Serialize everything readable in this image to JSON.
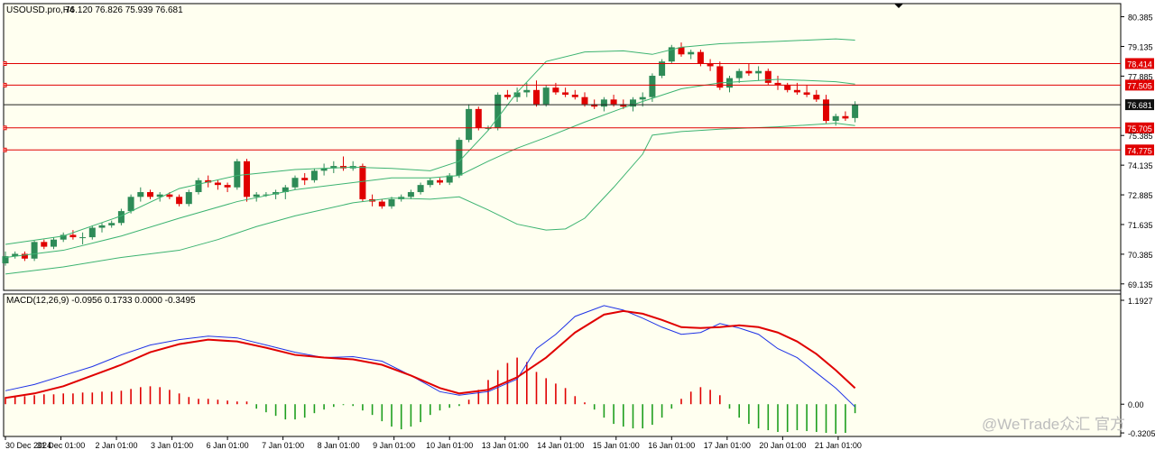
{
  "header": {
    "symbol": "USOUSD.pro,H4",
    "ohlc": "76.120 76.826 75.939 76.681"
  },
  "macd_header": "MACD(12,26,9) -0.0956 0.1733 0.0000 -0.3495",
  "watermark": "@WeTrade众汇 官方",
  "colors": {
    "background": "#fffff0",
    "bull_candle": "#2e8b57",
    "bear_candle": "#e00000",
    "bollinger": "#3cb371",
    "hline": "#e00000",
    "current_price_line": "#202020",
    "macd_line": "#1e32e6",
    "signal_line": "#e00000",
    "hist_pos": "#e00000",
    "hist_neg": "#1e9e1e"
  },
  "chart_data": [
    {
      "type": "candlestick",
      "title": "USOUSD.pro,H4",
      "ylim": [
        68.9,
        80.9
      ],
      "y_ticks": [
        "80.385",
        "79.135",
        "77.885",
        "75.385",
        "74.135",
        "72.885",
        "71.635",
        "70.385",
        "69.135"
      ],
      "horizontal_levels": [
        {
          "price": 78.414,
          "label": "78.414"
        },
        {
          "price": 77.505,
          "label": "77.505"
        },
        {
          "price": 75.705,
          "label": "75.705"
        },
        {
          "price": 74.775,
          "label": "74.775"
        }
      ],
      "current_price": {
        "price": 76.681,
        "label": "76.681"
      },
      "x_labels": [
        "30 Dec 2024",
        "31 Dec 01:00",
        "2 Jan 01:00",
        "3 Jan 01:00",
        "6 Jan 01:00",
        "7 Jan 01:00",
        "8 Jan 01:00",
        "9 Jan 01:00",
        "10 Jan 01:00",
        "13 Jan 01:00",
        "14 Jan 01:00",
        "15 Jan 01:00",
        "16 Jan 01:00",
        "17 Jan 01:00",
        "20 Jan 01:00",
        "21 Jan 01:00"
      ],
      "candles": [
        [
          70.0,
          70.5,
          69.9,
          70.3
        ],
        [
          70.3,
          70.5,
          70.2,
          70.4
        ],
        [
          70.4,
          70.5,
          70.1,
          70.2
        ],
        [
          70.2,
          70.95,
          70.1,
          70.9
        ],
        [
          70.9,
          71.0,
          70.6,
          70.7
        ],
        [
          70.7,
          71.1,
          70.6,
          71.0
        ],
        [
          71.0,
          71.3,
          70.9,
          71.2
        ],
        [
          71.2,
          71.4,
          71.0,
          71.1
        ],
        [
          71.1,
          71.3,
          70.8,
          71.1
        ],
        [
          71.1,
          71.6,
          71.0,
          71.5
        ],
        [
          71.5,
          71.7,
          71.3,
          71.6
        ],
        [
          71.6,
          71.8,
          71.5,
          71.7
        ],
        [
          71.7,
          72.3,
          71.6,
          72.2
        ],
        [
          72.2,
          72.9,
          72.1,
          72.8
        ],
        [
          72.8,
          73.2,
          72.6,
          73.0
        ],
        [
          73.0,
          73.1,
          72.7,
          72.8
        ],
        [
          72.8,
          73.0,
          72.6,
          72.9
        ],
        [
          72.9,
          73.0,
          72.7,
          72.8
        ],
        [
          72.8,
          72.9,
          72.4,
          72.5
        ],
        [
          72.5,
          73.1,
          72.4,
          73.0
        ],
        [
          73.0,
          73.6,
          72.9,
          73.5
        ],
        [
          73.5,
          73.7,
          73.2,
          73.4
        ],
        [
          73.4,
          73.5,
          73.1,
          73.3
        ],
        [
          73.3,
          73.4,
          73.0,
          73.2
        ],
        [
          73.2,
          74.4,
          73.1,
          74.3
        ],
        [
          74.3,
          74.4,
          72.6,
          72.8
        ],
        [
          72.8,
          73.0,
          72.6,
          72.9
        ],
        [
          72.9,
          73.0,
          72.8,
          72.9
        ],
        [
          72.9,
          73.1,
          72.7,
          73.0
        ],
        [
          73.0,
          73.3,
          72.7,
          73.2
        ],
        [
          73.2,
          73.7,
          73.1,
          73.6
        ],
        [
          73.6,
          73.8,
          73.3,
          73.5
        ],
        [
          73.5,
          74.0,
          73.4,
          73.9
        ],
        [
          73.9,
          74.2,
          73.7,
          74.0
        ],
        [
          74.0,
          74.3,
          73.8,
          74.1
        ],
        [
          74.1,
          74.5,
          73.9,
          74.0
        ],
        [
          74.0,
          74.3,
          73.9,
          74.1
        ],
        [
          74.1,
          74.2,
          72.6,
          72.7
        ],
        [
          72.7,
          72.9,
          72.4,
          72.6
        ],
        [
          72.6,
          72.7,
          72.3,
          72.4
        ],
        [
          72.4,
          72.8,
          72.3,
          72.7
        ],
        [
          72.7,
          72.9,
          72.6,
          72.8
        ],
        [
          72.8,
          73.1,
          72.7,
          73.0
        ],
        [
          73.0,
          73.4,
          72.9,
          73.3
        ],
        [
          73.3,
          73.6,
          73.2,
          73.5
        ],
        [
          73.5,
          73.6,
          73.3,
          73.4
        ],
        [
          73.4,
          73.8,
          73.3,
          73.7
        ],
        [
          73.7,
          75.3,
          73.6,
          75.2
        ],
        [
          75.2,
          76.7,
          75.1,
          76.5
        ],
        [
          76.5,
          76.6,
          75.6,
          75.7
        ],
        [
          75.7,
          75.8,
          75.6,
          75.7
        ],
        [
          75.7,
          77.2,
          75.6,
          77.1
        ],
        [
          77.1,
          77.3,
          76.9,
          77.0
        ],
        [
          77.0,
          77.4,
          76.8,
          77.2
        ],
        [
          77.2,
          77.6,
          77.0,
          77.3
        ],
        [
          77.3,
          77.7,
          76.6,
          76.7
        ],
        [
          76.7,
          77.5,
          76.6,
          77.4
        ],
        [
          77.4,
          77.6,
          77.1,
          77.2
        ],
        [
          77.2,
          77.4,
          77.0,
          77.1
        ],
        [
          77.1,
          77.3,
          76.9,
          77.0
        ],
        [
          77.0,
          77.2,
          76.6,
          76.7
        ],
        [
          76.7,
          76.9,
          76.5,
          76.6
        ],
        [
          76.6,
          77.0,
          76.4,
          76.9
        ],
        [
          76.9,
          77.1,
          76.6,
          76.7
        ],
        [
          76.7,
          76.9,
          76.5,
          76.6
        ],
        [
          76.6,
          77.0,
          76.4,
          76.9
        ],
        [
          76.9,
          77.2,
          76.6,
          77.0
        ],
        [
          77.0,
          78.0,
          76.8,
          77.9
        ],
        [
          77.9,
          78.6,
          77.8,
          78.5
        ],
        [
          78.5,
          79.2,
          78.4,
          79.1
        ],
        [
          79.1,
          79.3,
          78.7,
          78.8
        ],
        [
          78.8,
          79.0,
          78.6,
          78.9
        ],
        [
          78.9,
          79.0,
          78.3,
          78.4
        ],
        [
          78.4,
          78.6,
          78.1,
          78.3
        ],
        [
          78.3,
          78.5,
          77.3,
          77.4
        ],
        [
          77.4,
          77.9,
          77.2,
          77.8
        ],
        [
          77.8,
          78.2,
          77.6,
          78.1
        ],
        [
          78.1,
          78.4,
          77.9,
          78.0
        ],
        [
          78.0,
          78.3,
          77.7,
          78.1
        ],
        [
          78.1,
          78.2,
          77.5,
          77.6
        ],
        [
          77.6,
          77.9,
          77.3,
          77.5
        ],
        [
          77.5,
          77.6,
          77.2,
          77.3
        ],
        [
          77.3,
          77.6,
          77.1,
          77.2
        ],
        [
          77.2,
          77.5,
          77.0,
          77.1
        ],
        [
          77.1,
          77.3,
          76.8,
          76.9
        ],
        [
          76.9,
          77.1,
          75.9,
          76.0
        ],
        [
          76.0,
          76.3,
          75.8,
          76.2
        ],
        [
          76.2,
          76.4,
          76.0,
          76.1
        ],
        [
          76.12,
          76.826,
          75.939,
          76.681
        ]
      ],
      "bollinger_upper": [
        [
          0,
          70.8
        ],
        [
          6,
          71.15
        ],
        [
          12,
          72.0
        ],
        [
          18,
          73.15
        ],
        [
          24,
          73.7
        ],
        [
          30,
          73.95
        ],
        [
          36,
          74.05
        ],
        [
          40,
          74.0
        ],
        [
          44,
          73.9
        ],
        [
          47,
          74.3
        ],
        [
          50,
          75.6
        ],
        [
          53,
          77.2
        ],
        [
          56,
          78.5
        ],
        [
          60,
          78.9
        ],
        [
          64,
          78.95
        ],
        [
          67,
          78.8
        ],
        [
          70,
          79.1
        ],
        [
          74,
          79.25
        ],
        [
          80,
          79.35
        ],
        [
          86,
          79.45
        ],
        [
          88,
          79.4
        ]
      ],
      "bollinger_middle": [
        [
          0,
          70.25
        ],
        [
          6,
          70.55
        ],
        [
          12,
          71.15
        ],
        [
          18,
          71.9
        ],
        [
          24,
          72.6
        ],
        [
          30,
          73.1
        ],
        [
          36,
          73.4
        ],
        [
          40,
          73.6
        ],
        [
          44,
          73.6
        ],
        [
          47,
          73.7
        ],
        [
          50,
          74.3
        ],
        [
          53,
          74.85
        ],
        [
          56,
          75.3
        ],
        [
          60,
          75.95
        ],
        [
          64,
          76.55
        ],
        [
          67,
          76.95
        ],
        [
          70,
          77.35
        ],
        [
          74,
          77.6
        ],
        [
          80,
          77.75
        ],
        [
          86,
          77.65
        ],
        [
          88,
          77.55
        ]
      ],
      "bollinger_lower": [
        [
          0,
          69.55
        ],
        [
          6,
          69.85
        ],
        [
          12,
          70.25
        ],
        [
          18,
          70.55
        ],
        [
          22,
          71.0
        ],
        [
          26,
          71.55
        ],
        [
          30,
          72.0
        ],
        [
          36,
          72.55
        ],
        [
          40,
          72.75
        ],
        [
          44,
          72.7
        ],
        [
          47,
          72.8
        ],
        [
          50,
          72.25
        ],
        [
          53,
          71.65
        ],
        [
          56,
          71.4
        ],
        [
          58,
          71.45
        ],
        [
          60,
          71.9
        ],
        [
          63,
          73.2
        ],
        [
          66,
          74.6
        ],
        [
          67,
          75.4
        ],
        [
          70,
          75.55
        ],
        [
          74,
          75.65
        ],
        [
          80,
          75.75
        ],
        [
          86,
          75.9
        ],
        [
          88,
          75.8
        ]
      ]
    },
    {
      "type": "macd",
      "title": "MACD(12,26,9)",
      "ylim": [
        -0.35,
        1.22
      ],
      "y_ticks": [
        "1.1927",
        "0.00",
        "-0.3205"
      ],
      "macd_line": [
        [
          0,
          0.15
        ],
        [
          3,
          0.22
        ],
        [
          6,
          0.32
        ],
        [
          9,
          0.42
        ],
        [
          12,
          0.55
        ],
        [
          15,
          0.66
        ],
        [
          18,
          0.72
        ],
        [
          21,
          0.76
        ],
        [
          24,
          0.74
        ],
        [
          27,
          0.66
        ],
        [
          30,
          0.58
        ],
        [
          33,
          0.52
        ],
        [
          36,
          0.53
        ],
        [
          39,
          0.48
        ],
        [
          42,
          0.32
        ],
        [
          45,
          0.14
        ],
        [
          47,
          0.1
        ],
        [
          50,
          0.14
        ],
        [
          53,
          0.28
        ],
        [
          55,
          0.62
        ],
        [
          57,
          0.78
        ],
        [
          59,
          0.98
        ],
        [
          62,
          1.1
        ],
        [
          64,
          1.05
        ],
        [
          66,
          0.96
        ],
        [
          68,
          0.86
        ],
        [
          70,
          0.78
        ],
        [
          72,
          0.8
        ],
        [
          74,
          0.9
        ],
        [
          76,
          0.85
        ],
        [
          78,
          0.78
        ],
        [
          80,
          0.62
        ],
        [
          82,
          0.52
        ],
        [
          84,
          0.35
        ],
        [
          86,
          0.18
        ],
        [
          88,
          -0.03
        ]
      ],
      "signal_line": [
        [
          0,
          0.07
        ],
        [
          3,
          0.12
        ],
        [
          6,
          0.2
        ],
        [
          9,
          0.32
        ],
        [
          12,
          0.44
        ],
        [
          15,
          0.58
        ],
        [
          18,
          0.67
        ],
        [
          21,
          0.72
        ],
        [
          24,
          0.7
        ],
        [
          27,
          0.63
        ],
        [
          30,
          0.55
        ],
        [
          33,
          0.52
        ],
        [
          36,
          0.5
        ],
        [
          39,
          0.44
        ],
        [
          42,
          0.32
        ],
        [
          45,
          0.18
        ],
        [
          47,
          0.12
        ],
        [
          50,
          0.16
        ],
        [
          53,
          0.3
        ],
        [
          56,
          0.52
        ],
        [
          59,
          0.8
        ],
        [
          62,
          1.0
        ],
        [
          64,
          1.04
        ],
        [
          66,
          1.01
        ],
        [
          68,
          0.94
        ],
        [
          70,
          0.86
        ],
        [
          72,
          0.85
        ],
        [
          74,
          0.86
        ],
        [
          76,
          0.88
        ],
        [
          78,
          0.86
        ],
        [
          80,
          0.8
        ],
        [
          82,
          0.7
        ],
        [
          84,
          0.56
        ],
        [
          86,
          0.38
        ],
        [
          88,
          0.18
        ]
      ],
      "histogram": [
        0.08,
        0.09,
        0.09,
        0.1,
        0.11,
        0.11,
        0.12,
        0.12,
        0.13,
        0.13,
        0.14,
        0.14,
        0.15,
        0.17,
        0.19,
        0.2,
        0.19,
        0.16,
        0.12,
        0.08,
        0.06,
        0.06,
        0.05,
        0.04,
        0.03,
        0.03,
        -0.05,
        -0.09,
        -0.13,
        -0.17,
        -0.17,
        -0.15,
        -0.1,
        -0.06,
        -0.03,
        -0.01,
        -0.02,
        -0.07,
        -0.12,
        -0.19,
        -0.25,
        -0.28,
        -0.25,
        -0.2,
        -0.12,
        -0.07,
        -0.04,
        -0.02,
        0.05,
        0.16,
        0.27,
        0.38,
        0.46,
        0.52,
        0.47,
        0.36,
        0.29,
        0.23,
        0.18,
        0.09,
        0.02,
        -0.06,
        -0.15,
        -0.22,
        -0.25,
        -0.27,
        -0.27,
        -0.23,
        -0.15,
        -0.05,
        0.06,
        0.14,
        0.19,
        0.16,
        0.1,
        -0.05,
        -0.15,
        -0.22,
        -0.27,
        -0.29,
        -0.31,
        -0.31,
        -0.29,
        -0.3,
        -0.31,
        -0.32,
        -0.33,
        -0.32,
        -0.1
      ]
    }
  ]
}
